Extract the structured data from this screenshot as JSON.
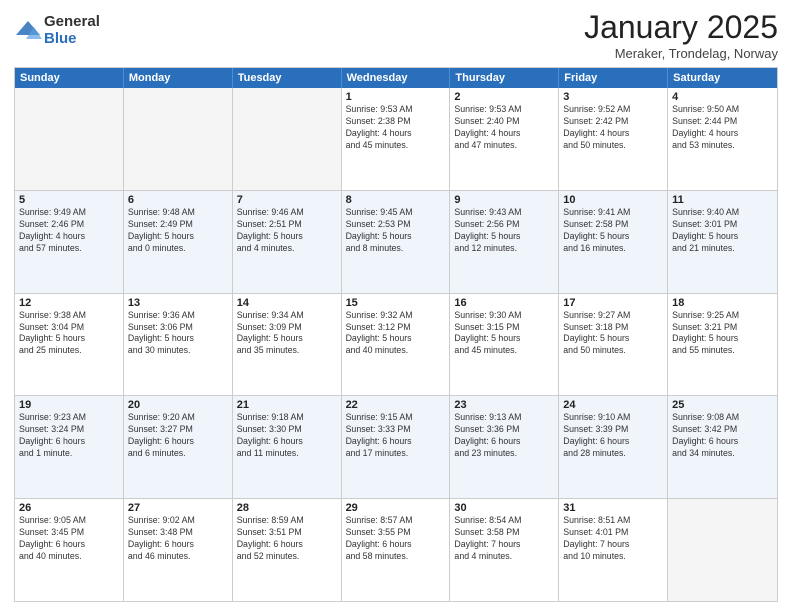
{
  "logo": {
    "general": "General",
    "blue": "Blue"
  },
  "title": "January 2025",
  "location": "Meraker, Trondelag, Norway",
  "days": [
    "Sunday",
    "Monday",
    "Tuesday",
    "Wednesday",
    "Thursday",
    "Friday",
    "Saturday"
  ],
  "weeks": [
    [
      {
        "day": "",
        "info": ""
      },
      {
        "day": "",
        "info": ""
      },
      {
        "day": "",
        "info": ""
      },
      {
        "day": "1",
        "info": "Sunrise: 9:53 AM\nSunset: 2:38 PM\nDaylight: 4 hours\nand 45 minutes."
      },
      {
        "day": "2",
        "info": "Sunrise: 9:53 AM\nSunset: 2:40 PM\nDaylight: 4 hours\nand 47 minutes."
      },
      {
        "day": "3",
        "info": "Sunrise: 9:52 AM\nSunset: 2:42 PM\nDaylight: 4 hours\nand 50 minutes."
      },
      {
        "day": "4",
        "info": "Sunrise: 9:50 AM\nSunset: 2:44 PM\nDaylight: 4 hours\nand 53 minutes."
      }
    ],
    [
      {
        "day": "5",
        "info": "Sunrise: 9:49 AM\nSunset: 2:46 PM\nDaylight: 4 hours\nand 57 minutes."
      },
      {
        "day": "6",
        "info": "Sunrise: 9:48 AM\nSunset: 2:49 PM\nDaylight: 5 hours\nand 0 minutes."
      },
      {
        "day": "7",
        "info": "Sunrise: 9:46 AM\nSunset: 2:51 PM\nDaylight: 5 hours\nand 4 minutes."
      },
      {
        "day": "8",
        "info": "Sunrise: 9:45 AM\nSunset: 2:53 PM\nDaylight: 5 hours\nand 8 minutes."
      },
      {
        "day": "9",
        "info": "Sunrise: 9:43 AM\nSunset: 2:56 PM\nDaylight: 5 hours\nand 12 minutes."
      },
      {
        "day": "10",
        "info": "Sunrise: 9:41 AM\nSunset: 2:58 PM\nDaylight: 5 hours\nand 16 minutes."
      },
      {
        "day": "11",
        "info": "Sunrise: 9:40 AM\nSunset: 3:01 PM\nDaylight: 5 hours\nand 21 minutes."
      }
    ],
    [
      {
        "day": "12",
        "info": "Sunrise: 9:38 AM\nSunset: 3:04 PM\nDaylight: 5 hours\nand 25 minutes."
      },
      {
        "day": "13",
        "info": "Sunrise: 9:36 AM\nSunset: 3:06 PM\nDaylight: 5 hours\nand 30 minutes."
      },
      {
        "day": "14",
        "info": "Sunrise: 9:34 AM\nSunset: 3:09 PM\nDaylight: 5 hours\nand 35 minutes."
      },
      {
        "day": "15",
        "info": "Sunrise: 9:32 AM\nSunset: 3:12 PM\nDaylight: 5 hours\nand 40 minutes."
      },
      {
        "day": "16",
        "info": "Sunrise: 9:30 AM\nSunset: 3:15 PM\nDaylight: 5 hours\nand 45 minutes."
      },
      {
        "day": "17",
        "info": "Sunrise: 9:27 AM\nSunset: 3:18 PM\nDaylight: 5 hours\nand 50 minutes."
      },
      {
        "day": "18",
        "info": "Sunrise: 9:25 AM\nSunset: 3:21 PM\nDaylight: 5 hours\nand 55 minutes."
      }
    ],
    [
      {
        "day": "19",
        "info": "Sunrise: 9:23 AM\nSunset: 3:24 PM\nDaylight: 6 hours\nand 1 minute."
      },
      {
        "day": "20",
        "info": "Sunrise: 9:20 AM\nSunset: 3:27 PM\nDaylight: 6 hours\nand 6 minutes."
      },
      {
        "day": "21",
        "info": "Sunrise: 9:18 AM\nSunset: 3:30 PM\nDaylight: 6 hours\nand 11 minutes."
      },
      {
        "day": "22",
        "info": "Sunrise: 9:15 AM\nSunset: 3:33 PM\nDaylight: 6 hours\nand 17 minutes."
      },
      {
        "day": "23",
        "info": "Sunrise: 9:13 AM\nSunset: 3:36 PM\nDaylight: 6 hours\nand 23 minutes."
      },
      {
        "day": "24",
        "info": "Sunrise: 9:10 AM\nSunset: 3:39 PM\nDaylight: 6 hours\nand 28 minutes."
      },
      {
        "day": "25",
        "info": "Sunrise: 9:08 AM\nSunset: 3:42 PM\nDaylight: 6 hours\nand 34 minutes."
      }
    ],
    [
      {
        "day": "26",
        "info": "Sunrise: 9:05 AM\nSunset: 3:45 PM\nDaylight: 6 hours\nand 40 minutes."
      },
      {
        "day": "27",
        "info": "Sunrise: 9:02 AM\nSunset: 3:48 PM\nDaylight: 6 hours\nand 46 minutes."
      },
      {
        "day": "28",
        "info": "Sunrise: 8:59 AM\nSunset: 3:51 PM\nDaylight: 6 hours\nand 52 minutes."
      },
      {
        "day": "29",
        "info": "Sunrise: 8:57 AM\nSunset: 3:55 PM\nDaylight: 6 hours\nand 58 minutes."
      },
      {
        "day": "30",
        "info": "Sunrise: 8:54 AM\nSunset: 3:58 PM\nDaylight: 7 hours\nand 4 minutes."
      },
      {
        "day": "31",
        "info": "Sunrise: 8:51 AM\nSunset: 4:01 PM\nDaylight: 7 hours\nand 10 minutes."
      },
      {
        "day": "",
        "info": ""
      }
    ]
  ]
}
